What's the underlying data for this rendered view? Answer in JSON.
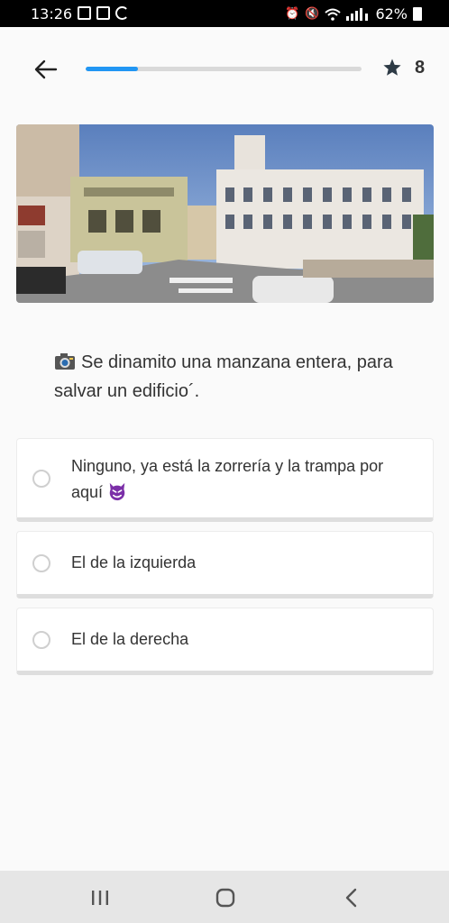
{
  "status_bar": {
    "time": "13:26",
    "battery": "62%",
    "icons": [
      "image-icon",
      "linkedin-icon",
      "sync-icon",
      "alarm-icon",
      "mute-icon",
      "wifi-icon",
      "signal-icon",
      "battery-icon"
    ]
  },
  "header": {
    "back_icon": "arrow-left-icon",
    "progress": 0.19,
    "progress_color": "#2196f3",
    "star_icon": "star-icon",
    "score": "8"
  },
  "question": {
    "icon": "camera-icon",
    "text": "Se dinamito una manzana entera, para salvar un edificio´."
  },
  "options": [
    {
      "label": "Ninguno, ya está la zorrería y la trampa por aquí",
      "emoji": "devil-icon"
    },
    {
      "label": "El de la izquierda"
    },
    {
      "label": "El de la derecha"
    }
  ],
  "nav_bar": {
    "recents_icon": "recents-icon",
    "home_icon": "home-icon",
    "back_icon": "back-chevron-icon"
  }
}
